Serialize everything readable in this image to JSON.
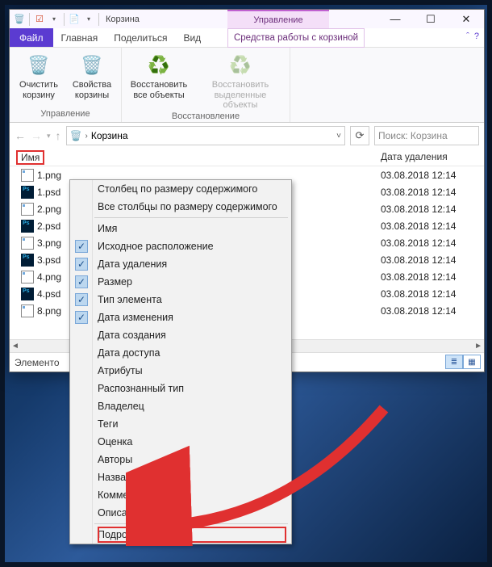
{
  "title": "Корзина",
  "context_tab": "Управление",
  "tabs": {
    "file": "Файл",
    "home": "Главная",
    "share": "Поделиться",
    "view": "Вид",
    "tools": "Средства работы с корзиной"
  },
  "ribbon": {
    "empty": "Очистить корзину",
    "props": "Свойства корзины",
    "restore_all": "Восстановить все объекты",
    "restore_sel": "Восстановить выделенные объекты",
    "group_manage": "Управление",
    "group_restore": "Восстановление"
  },
  "breadcrumb": "Корзина",
  "search_placeholder": "Поиск: Корзина",
  "columns": {
    "name": "Имя",
    "del_date": "Дата удаления"
  },
  "files": [
    {
      "name": "1.png",
      "type": "png",
      "date": "03.08.2018 12:14"
    },
    {
      "name": "1.psd",
      "type": "psd",
      "date": "03.08.2018 12:14"
    },
    {
      "name": "2.png",
      "type": "png",
      "date": "03.08.2018 12:14"
    },
    {
      "name": "2.psd",
      "type": "psd",
      "date": "03.08.2018 12:14"
    },
    {
      "name": "3.png",
      "type": "png",
      "date": "03.08.2018 12:14"
    },
    {
      "name": "3.psd",
      "type": "psd",
      "date": "03.08.2018 12:14"
    },
    {
      "name": "4.png",
      "type": "png",
      "date": "03.08.2018 12:14"
    },
    {
      "name": "4.psd",
      "type": "psd",
      "date": "03.08.2018 12:14"
    },
    {
      "name": "8.png",
      "type": "png",
      "date": "03.08.2018 12:14"
    }
  ],
  "status_label": "Элементо",
  "context_menu": {
    "size_content": "Столбец по размеру содержимого",
    "all_size_content": "Все столбцы по размеру содержимого",
    "checked": [
      {
        "label": "Имя",
        "on": false
      },
      {
        "label": "Исходное расположение",
        "on": true
      },
      {
        "label": "Дата удаления",
        "on": true
      },
      {
        "label": "Размер",
        "on": true
      },
      {
        "label": "Тип элемента",
        "on": true
      },
      {
        "label": "Дата изменения",
        "on": true
      }
    ],
    "unchecked": [
      "Дата создания",
      "Дата доступа",
      "Атрибуты",
      "Распознанный тип",
      "Владелец",
      "Теги",
      "Оценка",
      "Авторы",
      "Название",
      "Комментарии",
      "Описание файла"
    ],
    "more": "Подробнее..."
  }
}
